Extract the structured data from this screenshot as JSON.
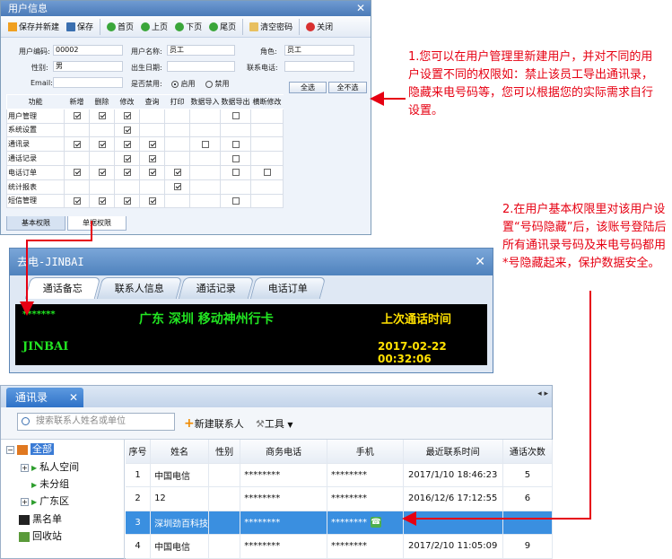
{
  "win1": {
    "title": "用户信息",
    "toolbar": [
      "保存并新建",
      "保存",
      "首页",
      "上页",
      "下页",
      "尾页",
      "清空密码",
      "关闭"
    ],
    "form": {
      "code_label": "用户编码:",
      "code_value": "00002",
      "name_label": "用户名称:",
      "name_value": "员工",
      "role_label": "角色:",
      "role_value": "员工",
      "gender_label": "性别:",
      "gender_value": "男",
      "birth_label": "出生日期:",
      "phone_label": "联系电话:",
      "email_label": "Email:",
      "disabled_label": "是否禁用:",
      "enabled_opt": "启用",
      "disabled_opt": "禁用",
      "select_all": "全选",
      "select_none": "全不选"
    },
    "perm_headers": [
      "功能",
      "新增",
      "删除",
      "修改",
      "查询",
      "打印",
      "数据导入",
      "数据导出",
      "横断修改"
    ],
    "perm_rows": [
      {
        "name": "用户管理",
        "cells": [
          1,
          1,
          1,
          0,
          0,
          0,
          1,
          0
        ]
      },
      {
        "name": "系统设置",
        "cells": [
          0,
          0,
          1,
          0,
          0,
          0,
          0,
          0
        ]
      },
      {
        "name": "通讯录",
        "cells": [
          1,
          1,
          1,
          1,
          0,
          1,
          1,
          0
        ]
      },
      {
        "name": "通话记录",
        "cells": [
          0,
          0,
          1,
          1,
          0,
          0,
          1,
          0
        ]
      },
      {
        "name": "电话订单",
        "cells": [
          1,
          1,
          1,
          1,
          1,
          0,
          1,
          1
        ]
      },
      {
        "name": "统计报表",
        "cells": [
          0,
          0,
          0,
          0,
          1,
          0,
          0,
          0
        ]
      },
      {
        "name": "短信管理",
        "cells": [
          1,
          1,
          1,
          1,
          0,
          0,
          1,
          0
        ]
      }
    ],
    "perm_has_box": [
      [
        1,
        1,
        1,
        0,
        0,
        0,
        1,
        0
      ],
      [
        0,
        0,
        1,
        0,
        0,
        0,
        0,
        0
      ],
      [
        1,
        1,
        1,
        1,
        0,
        1,
        1,
        0
      ],
      [
        0,
        0,
        1,
        1,
        0,
        0,
        1,
        0
      ],
      [
        1,
        1,
        1,
        1,
        1,
        0,
        1,
        1
      ],
      [
        0,
        0,
        0,
        0,
        1,
        0,
        0,
        0
      ],
      [
        1,
        1,
        1,
        1,
        0,
        0,
        1,
        0
      ]
    ],
    "tabs": [
      "基本权限",
      "单据权限"
    ]
  },
  "annotation1": "1.您可以在用户管理里新建用户，并对不同的用户设置不同的权限如：禁止该员工导出通讯录，隐藏来电号码等，您可以根据您的实际需求自行设置。",
  "annotation2": "2.在用户基本权限里对该用户设置“号码隐藏”后，该账号登陆后所有通讯录号码及来电号码都用*号隐藏起来，保护数据安全。",
  "win2": {
    "title": "去电-JINBAI",
    "tabs": [
      "通话备忘",
      "联系人信息",
      "通话记录",
      "电话订单"
    ],
    "led": {
      "masked_number": "*******",
      "location": "广东 深圳 移动神州行卡",
      "last_call_label": "上次通话时间",
      "name": "JINBAI",
      "last_call_time": "2017-02-22 00:32:06"
    },
    "colors": {
      "green": "#22e622",
      "yellow": "#ffe000"
    }
  },
  "win3": {
    "tab_label": "通讯录",
    "search_placeholder": "搜索联系人姓名或单位",
    "new_contact": "新建联系人",
    "tools": "工具",
    "tree": [
      "全部",
      "私人空间",
      "未分组",
      "广东区",
      "黑名单",
      "回收站"
    ],
    "columns": [
      "序号",
      "姓名",
      "性别",
      "商务电话",
      "手机",
      "最近联系时间",
      "通话次数"
    ],
    "rows": [
      {
        "no": "1",
        "name": "中国电信",
        "gender": "",
        "biz": "********",
        "mobile": "********",
        "time": "2017/1/10 18:46:23",
        "count": "5"
      },
      {
        "no": "2",
        "name": "12",
        "gender": "",
        "biz": "********",
        "mobile": "********",
        "time": "2016/12/6 17:12:55",
        "count": "6"
      },
      {
        "no": "3",
        "name": "深圳劲百科技",
        "gender": "",
        "biz": "********",
        "mobile": "********",
        "time": "",
        "count": ""
      },
      {
        "no": "4",
        "name": "中国电信",
        "gender": "",
        "biz": "********",
        "mobile": "********",
        "time": "2017/2/10 11:05:09",
        "count": "9"
      }
    ]
  }
}
